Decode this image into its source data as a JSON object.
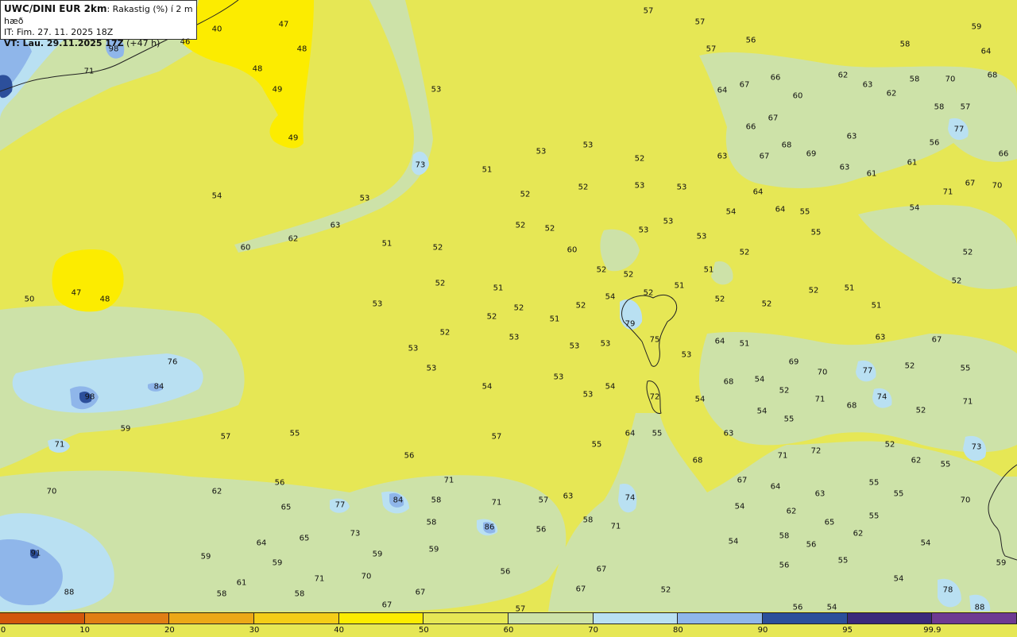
{
  "header": {
    "line1_bold": "UWC/DINI EUR 2km",
    "line1_rest": ": Rakastig (%) í 2 m hæð",
    "line2": "IT: Fim. 27. 11. 2025 18Z",
    "line3_bold": "VT: Lau. 29.11.2025 17Z",
    "line3_rest": " (+47 h)"
  },
  "colors": {
    "c0_10": "#d2570b",
    "c10_20": "#e07e14",
    "c20_30": "#eca818",
    "c30_40": "#f4cd18",
    "c40_50": "#fcec00",
    "c50_60": "#e6e755",
    "c60_70": "#cde2a8",
    "c70_80": "#b9e0f2",
    "c80_90": "#8fb6ea",
    "c90_95": "#2c4f9b",
    "c95_99_9": "#3b2a7b",
    "c99_9_100": "#6e3a92"
  },
  "legend": {
    "swatches": [
      "#d2570b",
      "#e07e14",
      "#eca818",
      "#f4cd18",
      "#fcec00",
      "#e6e755",
      "#cde2a8",
      "#b9e0f2",
      "#8fb6ea",
      "#2c4f9b",
      "#3b2a7b",
      "#6e3a92"
    ],
    "ticks": [
      "0",
      "10",
      "20",
      "30",
      "40",
      "50",
      "60",
      "70",
      "80",
      "90",
      "95",
      "99.9"
    ]
  },
  "values": [
    [
      "57",
      816,
      14
    ],
    [
      "57",
      881,
      28
    ],
    [
      "56",
      945,
      51
    ],
    [
      "57",
      895,
      62
    ],
    [
      "58",
      1139,
      56
    ],
    [
      "59",
      1229,
      34
    ],
    [
      "64",
      1241,
      65
    ],
    [
      "68",
      1249,
      95
    ],
    [
      "47",
      357,
      31
    ],
    [
      "40",
      273,
      37
    ],
    [
      "46",
      233,
      53
    ],
    [
      "48",
      380,
      62
    ],
    [
      "48",
      324,
      87
    ],
    [
      "49",
      349,
      113
    ],
    [
      "49",
      369,
      174
    ],
    [
      "98",
      143,
      62
    ],
    [
      "71",
      112,
      90
    ],
    [
      "53",
      549,
      113
    ],
    [
      "64",
      909,
      114
    ],
    [
      "67",
      937,
      107
    ],
    [
      "66",
      976,
      98
    ],
    [
      "62",
      1061,
      95
    ],
    [
      "63",
      1092,
      107
    ],
    [
      "62",
      1122,
      118
    ],
    [
      "58",
      1151,
      100
    ],
    [
      "70",
      1196,
      100
    ],
    [
      "60",
      1004,
      121
    ],
    [
      "58",
      1182,
      135
    ],
    [
      "57",
      1215,
      135
    ],
    [
      "67",
      973,
      149
    ],
    [
      "66",
      945,
      160
    ],
    [
      "77",
      1207,
      163
    ],
    [
      "63",
      1072,
      172
    ],
    [
      "56",
      1176,
      180
    ],
    [
      "66",
      1263,
      194
    ],
    [
      "53",
      681,
      191
    ],
    [
      "53",
      740,
      183
    ],
    [
      "52",
      805,
      200
    ],
    [
      "63",
      909,
      197
    ],
    [
      "67",
      962,
      197
    ],
    [
      "68",
      990,
      183
    ],
    [
      "69",
      1021,
      194
    ],
    [
      "63",
      1063,
      211
    ],
    [
      "61",
      1097,
      219
    ],
    [
      "61",
      1148,
      205
    ],
    [
      "73",
      529,
      208
    ],
    [
      "51",
      613,
      214
    ],
    [
      "54",
      273,
      247
    ],
    [
      "53",
      459,
      250
    ],
    [
      "52",
      661,
      245
    ],
    [
      "52",
      734,
      236
    ],
    [
      "53",
      805,
      234
    ],
    [
      "53",
      858,
      236
    ],
    [
      "64",
      954,
      242
    ],
    [
      "71",
      1193,
      242
    ],
    [
      "67",
      1221,
      231
    ],
    [
      "70",
      1255,
      234
    ],
    [
      "52",
      655,
      284
    ],
    [
      "52",
      692,
      288
    ],
    [
      "53",
      810,
      290
    ],
    [
      "53",
      841,
      279
    ],
    [
      "54",
      920,
      267
    ],
    [
      "64",
      982,
      264
    ],
    [
      "55",
      1013,
      267
    ],
    [
      "54",
      1151,
      262
    ],
    [
      "55",
      1027,
      293
    ],
    [
      "63",
      422,
      284
    ],
    [
      "62",
      369,
      301
    ],
    [
      "60",
      309,
      312
    ],
    [
      "51",
      487,
      307
    ],
    [
      "52",
      551,
      312
    ],
    [
      "60",
      720,
      315
    ],
    [
      "53",
      883,
      298
    ],
    [
      "52",
      937,
      318
    ],
    [
      "52",
      1218,
      318
    ],
    [
      "52",
      757,
      340
    ],
    [
      "52",
      791,
      346
    ],
    [
      "51",
      892,
      340
    ],
    [
      "51",
      855,
      360
    ],
    [
      "52",
      1204,
      354
    ],
    [
      "50",
      37,
      377
    ],
    [
      "47",
      96,
      369
    ],
    [
      "48",
      132,
      377
    ],
    [
      "53",
      475,
      383
    ],
    [
      "52",
      554,
      357
    ],
    [
      "51",
      627,
      363
    ],
    [
      "52",
      653,
      388
    ],
    [
      "52",
      731,
      385
    ],
    [
      "54",
      768,
      374
    ],
    [
      "52",
      816,
      369
    ],
    [
      "52",
      906,
      377
    ],
    [
      "52",
      965,
      383
    ],
    [
      "52",
      1024,
      366
    ],
    [
      "51",
      1069,
      363
    ],
    [
      "51",
      1103,
      385
    ],
    [
      "52",
      619,
      399
    ],
    [
      "51",
      698,
      402
    ],
    [
      "79",
      793,
      408
    ],
    [
      "53",
      520,
      439
    ],
    [
      "52",
      560,
      419
    ],
    [
      "53",
      647,
      425
    ],
    [
      "53",
      723,
      436
    ],
    [
      "53",
      762,
      433
    ],
    [
      "75",
      824,
      428
    ],
    [
      "53",
      864,
      447
    ],
    [
      "64",
      906,
      430
    ],
    [
      "51",
      937,
      433
    ],
    [
      "63",
      1108,
      425
    ],
    [
      "67",
      1179,
      428
    ],
    [
      "76",
      217,
      456
    ],
    [
      "53",
      543,
      464
    ],
    [
      "53",
      703,
      475
    ],
    [
      "69",
      999,
      456
    ],
    [
      "70",
      1035,
      469
    ],
    [
      "77",
      1092,
      467
    ],
    [
      "52",
      1145,
      461
    ],
    [
      "55",
      1215,
      464
    ],
    [
      "84",
      200,
      487
    ],
    [
      "98",
      113,
      500
    ],
    [
      "54",
      613,
      487
    ],
    [
      "54",
      768,
      487
    ],
    [
      "68",
      917,
      481
    ],
    [
      "54",
      956,
      478
    ],
    [
      "52",
      987,
      492
    ],
    [
      "53",
      740,
      497
    ],
    [
      "72",
      824,
      500
    ],
    [
      "54",
      881,
      503
    ],
    [
      "71",
      1032,
      503
    ],
    [
      "74",
      1110,
      500
    ],
    [
      "68",
      1072,
      511
    ],
    [
      "71",
      1218,
      506
    ],
    [
      "54",
      959,
      518
    ],
    [
      "52",
      1159,
      517
    ],
    [
      "55",
      993,
      528
    ],
    [
      "59",
      158,
      540
    ],
    [
      "57",
      284,
      550
    ],
    [
      "55",
      371,
      546
    ],
    [
      "57",
      625,
      550
    ],
    [
      "64",
      793,
      546
    ],
    [
      "55",
      827,
      546
    ],
    [
      "63",
      917,
      546
    ],
    [
      "71",
      75,
      560
    ],
    [
      "55",
      751,
      560
    ],
    [
      "56",
      515,
      574
    ],
    [
      "68",
      878,
      580
    ],
    [
      "71",
      985,
      574
    ],
    [
      "72",
      1027,
      568
    ],
    [
      "52",
      1120,
      560
    ],
    [
      "73",
      1229,
      563
    ],
    [
      "62",
      1153,
      580
    ],
    [
      "55",
      1190,
      585
    ],
    [
      "56",
      352,
      608
    ],
    [
      "71",
      565,
      605
    ],
    [
      "67",
      934,
      605
    ],
    [
      "64",
      976,
      613
    ],
    [
      "55",
      1100,
      608
    ],
    [
      "70",
      65,
      619
    ],
    [
      "62",
      273,
      619
    ],
    [
      "63",
      1032,
      622
    ],
    [
      "55",
      1131,
      622
    ],
    [
      "65",
      360,
      639
    ],
    [
      "77",
      428,
      636
    ],
    [
      "84",
      501,
      630
    ],
    [
      "58",
      549,
      630
    ],
    [
      "71",
      625,
      633
    ],
    [
      "57",
      684,
      630
    ],
    [
      "63",
      715,
      625
    ],
    [
      "74",
      793,
      627
    ],
    [
      "54",
      931,
      638
    ],
    [
      "62",
      996,
      644
    ],
    [
      "70",
      1215,
      630
    ],
    [
      "73",
      447,
      672
    ],
    [
      "58",
      543,
      658
    ],
    [
      "86",
      616,
      664
    ],
    [
      "56",
      681,
      667
    ],
    [
      "58",
      740,
      655
    ],
    [
      "71",
      775,
      663
    ],
    [
      "65",
      1044,
      658
    ],
    [
      "55",
      1100,
      650
    ],
    [
      "62",
      1080,
      672
    ],
    [
      "64",
      329,
      684
    ],
    [
      "65",
      383,
      678
    ],
    [
      "58",
      987,
      675
    ],
    [
      "56",
      1021,
      686
    ],
    [
      "54",
      923,
      682
    ],
    [
      "54",
      1165,
      684
    ],
    [
      "91",
      45,
      697
    ],
    [
      "59",
      259,
      701
    ],
    [
      "59",
      349,
      709
    ],
    [
      "59",
      475,
      698
    ],
    [
      "59",
      546,
      692
    ],
    [
      "55",
      1061,
      706
    ],
    [
      "59",
      1260,
      709
    ],
    [
      "71",
      402,
      729
    ],
    [
      "70",
      461,
      726
    ],
    [
      "56",
      636,
      720
    ],
    [
      "67",
      757,
      717
    ],
    [
      "56",
      987,
      712
    ],
    [
      "54",
      1131,
      729
    ],
    [
      "88",
      87,
      746
    ],
    [
      "61",
      304,
      734
    ],
    [
      "58",
      279,
      748
    ],
    [
      "58",
      377,
      748
    ],
    [
      "67",
      529,
      746
    ],
    [
      "67",
      731,
      742
    ],
    [
      "52",
      838,
      743
    ],
    [
      "78",
      1193,
      743
    ],
    [
      "67",
      487,
      762
    ],
    [
      "57",
      655,
      767
    ],
    [
      "56",
      1004,
      765
    ],
    [
      "54",
      1047,
      765
    ],
    [
      "88",
      1233,
      765
    ]
  ]
}
